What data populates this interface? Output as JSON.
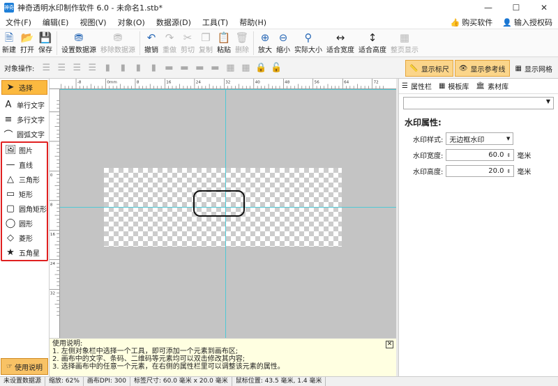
{
  "app": {
    "title": "神奇透明水印制作软件 6.0 - 未命名1.stb*",
    "icon_text": "神奇"
  },
  "menu": {
    "items": [
      "文件(F)",
      "编辑(E)",
      "视图(V)",
      "对象(O)",
      "数据源(D)",
      "工具(T)",
      "帮助(H)"
    ],
    "buy": "购买软件",
    "license": "输入授权码"
  },
  "toolbar": {
    "new": "新建",
    "open": "打开",
    "save": "保存",
    "set_ds": "设置数据源",
    "remove_ds": "移除数据源",
    "undo": "撤销",
    "redo": "重做",
    "cut": "剪切",
    "copy": "复制",
    "paste": "粘贴",
    "delete": "删除",
    "zoom_in": "放大",
    "zoom_out": "缩小",
    "actual_size": "实际大小",
    "fit_width": "适合宽度",
    "fit_height": "适合高度",
    "full_page": "整页显示"
  },
  "objbar": {
    "label": "对象操作:",
    "show_ruler": "显示标尺",
    "show_guides": "显示参考线",
    "show_grid": "显示网格"
  },
  "tools": {
    "select": "选择",
    "single_text": "单行文字",
    "multi_text": "多行文字",
    "arc_text": "圆弧文字",
    "image": "图片",
    "line": "直线",
    "triangle": "三角形",
    "rect": "矩形",
    "round_rect": "圆角矩形",
    "circle": "圆形",
    "diamond": "菱形",
    "star": "五角星",
    "help": "使用说明"
  },
  "hint": {
    "title": "使用说明:",
    "line1": "1. 左侧对象栏中选择一个工具，即可添加一个元素到画布区;",
    "line2": "2. 画布中的文字、条码、二维码等元素均可以双击修改其内容;",
    "line3": "3. 选择画布中的任意一个元素，在右侧的属性栏里可以调整该元素的属性。"
  },
  "right": {
    "tab1": "属性栏",
    "tab2": "模板库",
    "tab3": "素材库",
    "section": "水印属性:",
    "style_label": "水印样式:",
    "style_value": "无边框水印",
    "width_label": "水印宽度:",
    "width_value": "60.0",
    "height_label": "水印高度:",
    "height_value": "20.0",
    "unit": "毫米"
  },
  "ruler": {
    "h_labels": [
      "-8",
      "0mm",
      "8",
      "16",
      "24",
      "32",
      "40",
      "48",
      "56",
      "64",
      "72"
    ],
    "v_labels": [
      "0",
      "8",
      "16",
      "24",
      "32"
    ]
  },
  "status": {
    "ds": "未设置数据源",
    "zoom": "缩放: 62%",
    "dpi": "画布DPI: 300",
    "size": "标签尺寸: 60.0 毫米 x 20.0 毫米",
    "mouse": "鼠标位置: 43.5 毫米, 1.4 毫米"
  }
}
